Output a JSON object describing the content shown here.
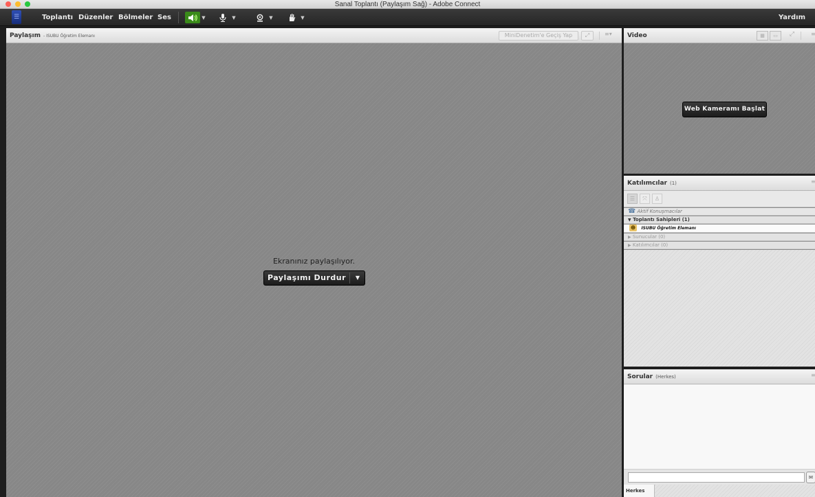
{
  "window": {
    "title": "Sanal Toplantı (Paylaşım Sağ) - Adobe Connect",
    "colors": {
      "close": "#fc5f57",
      "minimize": "#fdbc2e",
      "zoom": "#28c840"
    }
  },
  "menubar": {
    "logo_icon": "adobe-connect-logo",
    "items": [
      "Toplantı",
      "Düzenler",
      "Bölmeler",
      "Ses"
    ],
    "help_label": "Yardım",
    "toolbar": {
      "speaker_icon": "speaker-icon",
      "mic_icon": "microphone-icon",
      "camera_icon": "webcam-icon",
      "status_icon": "raise-hand-icon",
      "speaker_active_color": "#3a8a1a"
    }
  },
  "share_pod": {
    "title": "Paylaşım",
    "subtitle": "- ISUBU Öğretim Elemanı",
    "mini_control_label": "MiniDenetim'e Geçiş Yap",
    "status_text": "Ekranınız paylaşılıyor.",
    "stop_button_label": "Paylaşımı Durdur",
    "stop_button_arrow": "▼"
  },
  "video_pod": {
    "title": "Video",
    "start_webcam_label": "Web Kameramı Başlat"
  },
  "attendees_pod": {
    "title": "Katılımcılar",
    "count": "(1)",
    "active_speakers_label": "Aktif Konuşmacılar",
    "groups": [
      {
        "label": "Toplantı Sahipleri (1)",
        "expanded": true
      },
      {
        "label": "Sunucular (0)",
        "expanded": false
      },
      {
        "label": "Katılımcılar (0)",
        "expanded": false
      }
    ],
    "host_user": "ISUBU Öğretim Elemanı"
  },
  "questions_pod": {
    "title": "Sorular",
    "subtitle": "(Herkes)",
    "input_placeholder": "",
    "tab_label": "Herkes"
  }
}
